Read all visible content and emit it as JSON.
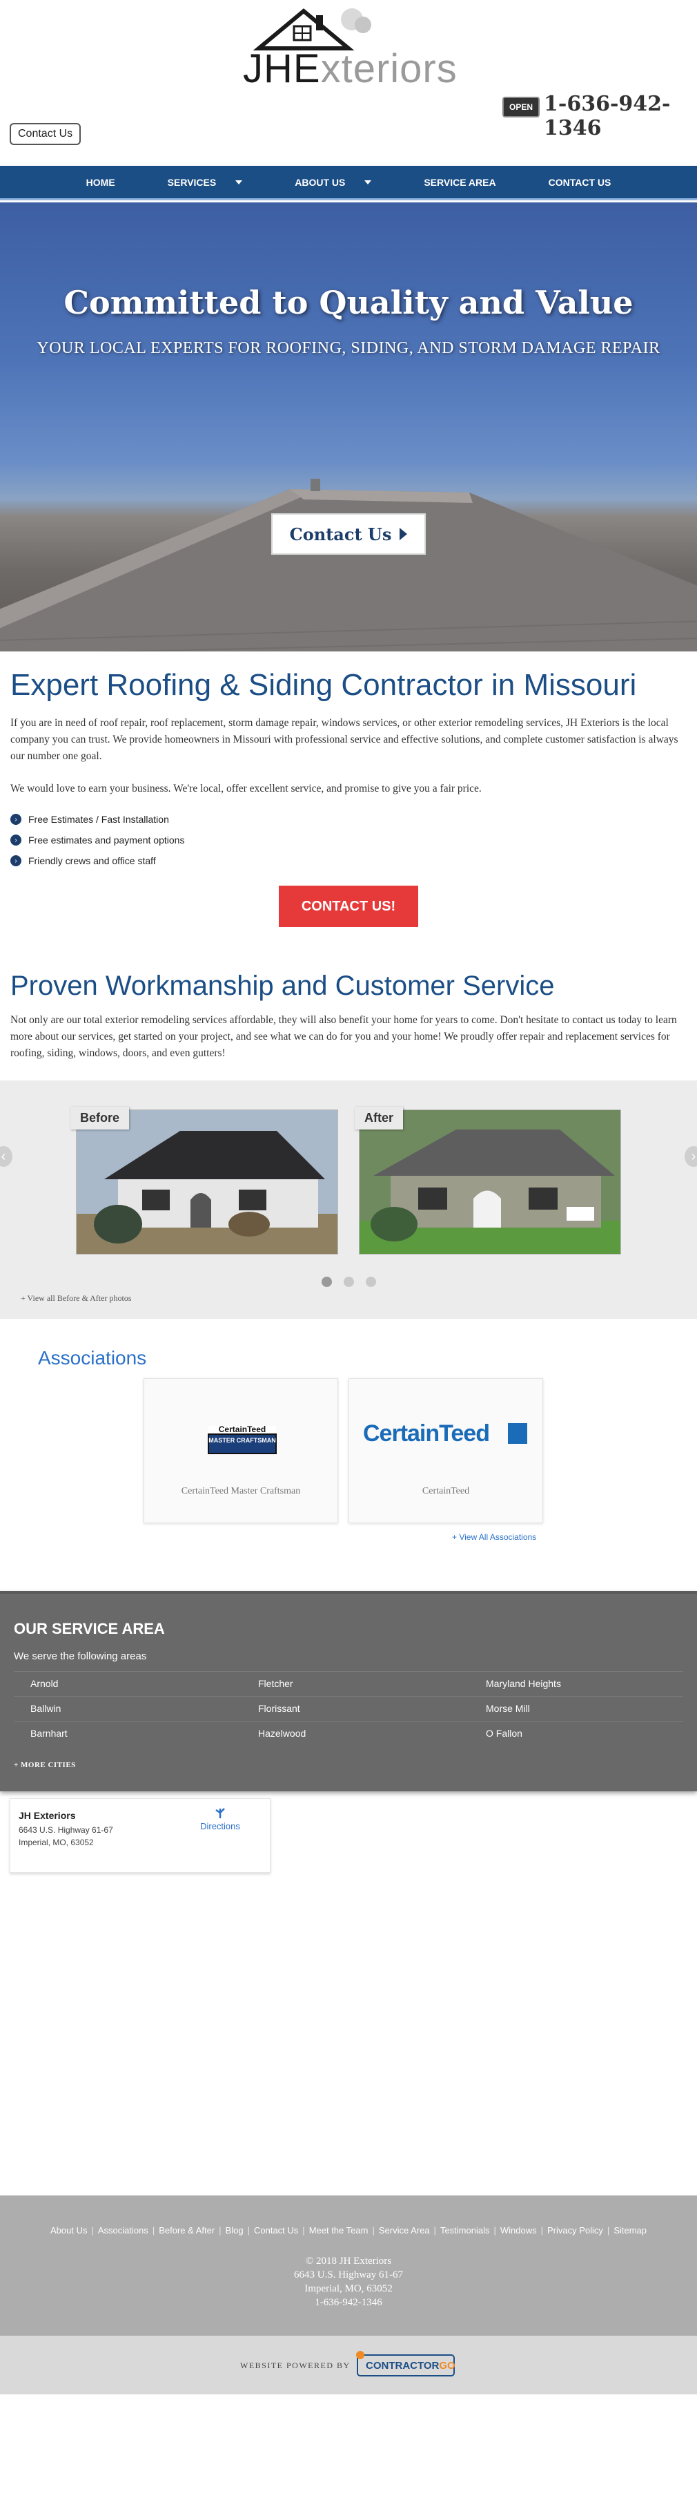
{
  "header": {
    "logo_main": "JHE",
    "logo_light": "xteriors",
    "contact_label": "Contact Us",
    "open_badge": "OPEN",
    "phone": "1-636-942-1346"
  },
  "nav": {
    "items": [
      {
        "label": "HOME"
      },
      {
        "label": "SERVICES"
      },
      {
        "label": "ABOUT US"
      },
      {
        "label": "SERVICE AREA"
      },
      {
        "label": "CONTACT US"
      }
    ]
  },
  "hero": {
    "title": "Committed to Quality and Value",
    "subtitle": "YOUR LOCAL EXPERTS FOR ROOFING, SIDING, AND STORM DAMAGE REPAIR",
    "button": "Contact Us"
  },
  "expert": {
    "title": "Expert Roofing & Siding Contractor in Missouri",
    "p1": "If you are in need of roof repair, roof replacement, storm damage repair, windows services, or other exterior remodeling services, JH Exteriors is the local company you can trust. We provide homeowners in Missouri with professional service and effective solutions, and complete customer satisfaction is always our number one goal.",
    "p2": "We would love to earn your business. We're local, offer excellent service, and promise to give you a fair price.",
    "checklist": [
      "Free Estimates / Fast Installation",
      "Free estimates and payment options",
      "Friendly crews and office staff"
    ],
    "cta": "CONTACT US!"
  },
  "proven": {
    "title": "Proven Workmanship and Customer Service",
    "p": "Not only are our total exterior remodeling services affordable, they will also benefit your home for years to come. Don't hesitate to contact us today to learn more about our services, get started on your project, and see what we can do for you and your home! We proudly offer repair and replacement services for roofing, siding, windows, doors, and even gutters!"
  },
  "before_after": {
    "before_label": "Before",
    "after_label": "After",
    "view_all": "+ View all Before & After photos"
  },
  "associations": {
    "title": "Associations",
    "items": [
      {
        "name": "CertainTeed Master Craftsman",
        "logo_top": "CertainTeed",
        "logo_bottom": "MASTER CRAFTSMAN"
      },
      {
        "name": "CertainTeed",
        "logo_text": "CertainTeed"
      }
    ],
    "view_all": "+ View All Associations"
  },
  "service_area": {
    "title": "OUR SERVICE AREA",
    "subtitle": "We serve the following areas",
    "cities": [
      "Arnold",
      "Fletcher",
      "Maryland Heights",
      "Ballwin",
      "Florissant",
      "Morse Mill",
      "Barnhart",
      "Hazelwood",
      "O Fallon"
    ],
    "more": "+ MORE CITIES"
  },
  "map_card": {
    "name": "JH Exteriors",
    "line1": "6643 U.S. Highway 61-67",
    "line2": "Imperial, MO, 63052",
    "directions": "Directions"
  },
  "footer": {
    "links": [
      "About Us",
      "Associations",
      "Before & After",
      "Blog",
      "Contact Us",
      "Meet the Team",
      "Service Area",
      "Testimonials",
      "Windows",
      "Privacy Policy",
      "Sitemap"
    ],
    "copyright": "© 2018 JH Exteriors",
    "address1": "6643 U.S. Highway 61-67",
    "address2": "Imperial, MO, 63052",
    "phone": "1-636-942-1346",
    "powered_by": "WEBSITE POWERED BY",
    "powered_logo": "CONTRACTOR",
    "powered_logo_suffix": "GO"
  },
  "colors": {
    "nav_blue": "#1c4e86",
    "heading_blue": "#1c4e86",
    "link_blue": "#2a70c9",
    "cta_red": "#e63a3a",
    "service_gray": "#696969",
    "footer_gray": "#adadad"
  }
}
